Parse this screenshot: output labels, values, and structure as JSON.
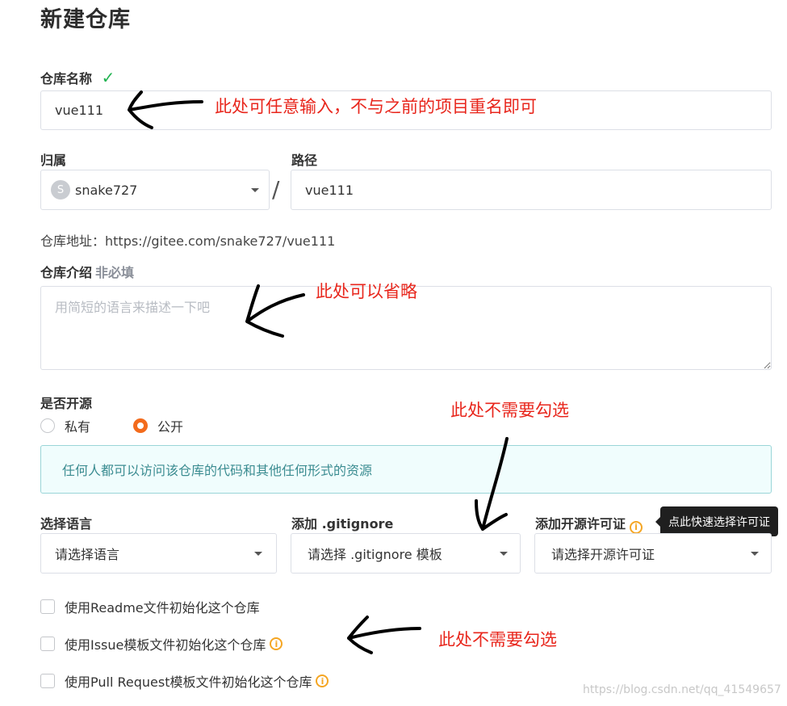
{
  "page": {
    "title": "新建仓库"
  },
  "repo_name": {
    "label": "仓库名称",
    "value": "vue111"
  },
  "owner": {
    "label": "归属",
    "avatar_letter": "S",
    "value": "snake727"
  },
  "path": {
    "label": "路径",
    "separator": "/",
    "value": "vue111"
  },
  "repo_address": {
    "text": "仓库地址：https://gitee.com/snake727/vue111"
  },
  "description": {
    "label": "仓库介绍",
    "optional": "非必填",
    "placeholder": "用简短的语言来描述一下吧"
  },
  "visibility": {
    "label": "是否开源",
    "options": [
      {
        "label": "私有",
        "selected": false
      },
      {
        "label": "公开",
        "selected": true
      }
    ],
    "info": "任何人都可以访问该仓库的代码和其他任何形式的资源"
  },
  "language": {
    "label": "选择语言",
    "placeholder": "请选择语言"
  },
  "gitignore": {
    "label": "添加 .gitignore",
    "placeholder": "请选择 .gitignore 模板"
  },
  "license": {
    "label": "添加开源许可证",
    "placeholder": "请选择开源许可证",
    "tooltip": "点此快速选择许可证"
  },
  "init_options": [
    {
      "label": "使用Readme文件初始化这个仓库",
      "info": false
    },
    {
      "label": "使用Issue模板文件初始化这个仓库",
      "info": true
    },
    {
      "label": "使用Pull Request模板文件初始化这个仓库",
      "info": true
    }
  ],
  "annotations": {
    "name_note": "此处可任意输入，不与之前的项目重名即可",
    "desc_note": "此处可以省略",
    "gitignore_note": "此处不需要勾选",
    "init_note": "此处不需要勾选"
  },
  "watermark": "https://blog.csdn.net/qq_41549657",
  "colors": {
    "accent": "#f36b1c",
    "annotation": "#e8261c",
    "success": "#21b351",
    "info_border": "#9ad5d8"
  }
}
